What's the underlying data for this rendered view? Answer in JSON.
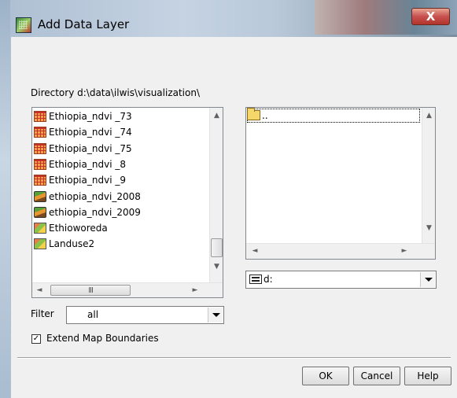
{
  "window": {
    "title": "Add Data Layer",
    "close_label": "X"
  },
  "directory_label": "Directory d:\\data\\ilwis\\visualization\\",
  "files": [
    {
      "name": "Ethiopia_ndvi _73",
      "icon": "raster-map-icon"
    },
    {
      "name": "Ethiopia_ndvi _74",
      "icon": "raster-map-icon"
    },
    {
      "name": "Ethiopia_ndvi _75",
      "icon": "raster-map-icon"
    },
    {
      "name": "Ethiopia_ndvi _8",
      "icon": "raster-map-icon"
    },
    {
      "name": "Ethiopia_ndvi _9",
      "icon": "raster-map-icon"
    },
    {
      "name": "ethiopia_ndvi_2008",
      "icon": "map-list-icon"
    },
    {
      "name": "ethiopia_ndvi_2009",
      "icon": "map-list-icon"
    },
    {
      "name": "Ethioworeda",
      "icon": "polygon-map-icon"
    },
    {
      "name": "Landuse2",
      "icon": "polygon-map-icon"
    }
  ],
  "directories": [
    {
      "name": "..",
      "icon": "folder-icon"
    }
  ],
  "drive": {
    "value": "d:"
  },
  "filter": {
    "label": "Filter",
    "value": "all"
  },
  "extend_map_boundaries": {
    "label": "Extend Map Boundaries",
    "checked": true
  },
  "buttons": {
    "ok": "OK",
    "cancel": "Cancel",
    "help": "Help"
  },
  "scroll_glyphs": {
    "up": "▲",
    "down": "▼",
    "left": "◄",
    "right": "►",
    "grip": "III"
  }
}
